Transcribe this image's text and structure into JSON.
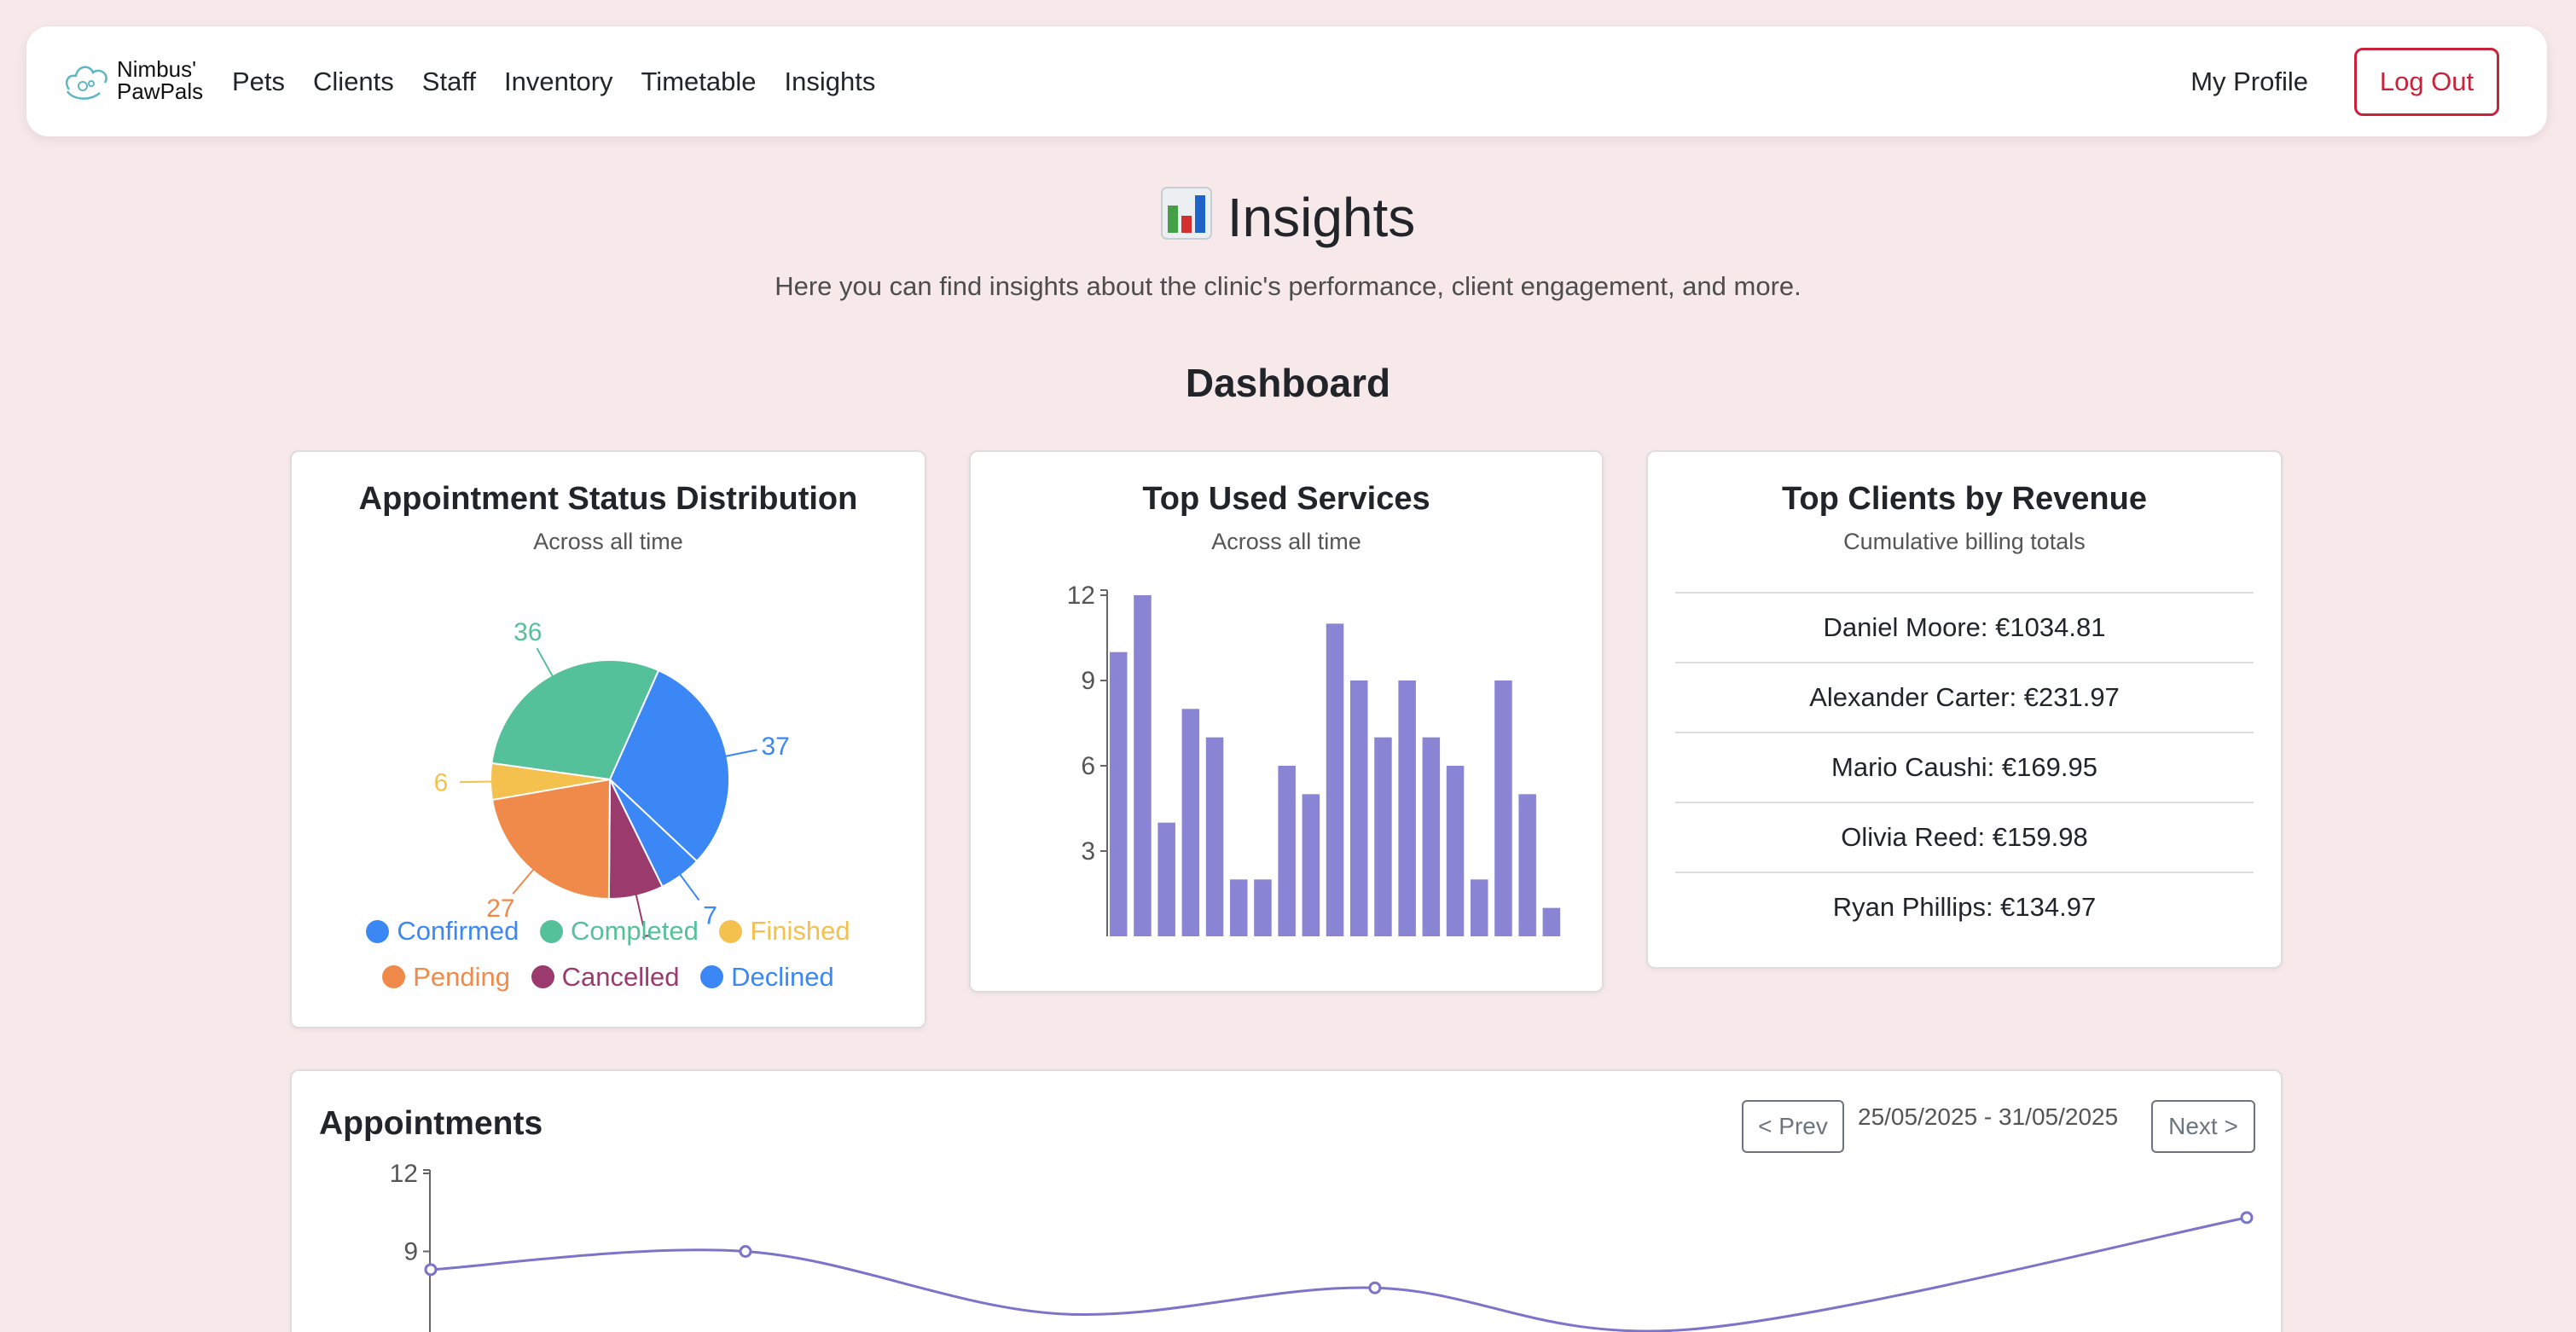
{
  "navbar": {
    "logo_line1": "Nimbus'",
    "logo_line2": "PawPals",
    "links": [
      "Pets",
      "Clients",
      "Staff",
      "Inventory",
      "Timetable",
      "Insights"
    ],
    "profile": "My Profile",
    "logout": "Log Out"
  },
  "page": {
    "title": "Insights",
    "subtitle": "Here you can find insights about the clinic's performance, client engagement, and more.",
    "dashboard_title": "Dashboard"
  },
  "status_card": {
    "title": "Appointment Status Distribution",
    "subtitle": "Across all time"
  },
  "services_card": {
    "title": "Top Used Services",
    "subtitle": "Across all time"
  },
  "revenue_card": {
    "title": "Top Clients by Revenue",
    "subtitle": "Cumulative billing totals",
    "clients": [
      "Daniel Moore: €1034.81",
      "Alexander Carter: €231.97",
      "Mario Caushi: €169.95",
      "Olivia Reed: €159.98",
      "Ryan Phillips: €134.97"
    ]
  },
  "appointments_card": {
    "title": "Appointments",
    "prev": "< Prev",
    "next": "Next >",
    "date_range": "25/05/2025 - 31/05/2025"
  },
  "chart_data": [
    {
      "type": "pie",
      "labels": [
        "Confirmed",
        "Declined",
        "Cancelled",
        "Pending",
        "Finished",
        "Completed"
      ],
      "values": [
        37,
        7,
        9,
        27,
        6,
        36
      ],
      "colors": [
        "#3b87f5",
        "#3b87f5",
        "#9b3a6c",
        "#f08a4b",
        "#f4c04e",
        "#55c19a"
      ],
      "legend": [
        "Confirmed",
        "Completed",
        "Finished",
        "Pending",
        "Cancelled",
        "Declined"
      ],
      "legend_colors": [
        "#3b87f5",
        "#55c19a",
        "#f4c04e",
        "#f08a4b",
        "#9b3a6c",
        "#3b87f5"
      ]
    },
    {
      "type": "bar",
      "values": [
        10,
        12,
        4,
        8,
        7,
        2,
        2,
        6,
        5,
        11,
        9,
        7,
        9,
        7,
        6,
        2,
        9,
        5,
        1
      ],
      "ylim": [
        0,
        12
      ],
      "yticks": [
        3,
        6,
        9,
        12
      ],
      "color": "#8a84d4"
    },
    {
      "type": "line",
      "ylim": [
        0,
        12
      ],
      "yticks": [
        9,
        12
      ],
      "points": [
        {
          "x": 0,
          "y": 8.3
        },
        {
          "x": 1,
          "y": 9.0
        },
        {
          "x": 2,
          "y": 6.6
        },
        {
          "x": 3,
          "y": 7.6
        },
        {
          "x": 4,
          "y": 6.0
        },
        {
          "x": 5,
          "y": 10.3
        }
      ],
      "visible_markers": [
        0,
        1,
        3,
        5
      ],
      "color": "#7b74c9"
    }
  ]
}
